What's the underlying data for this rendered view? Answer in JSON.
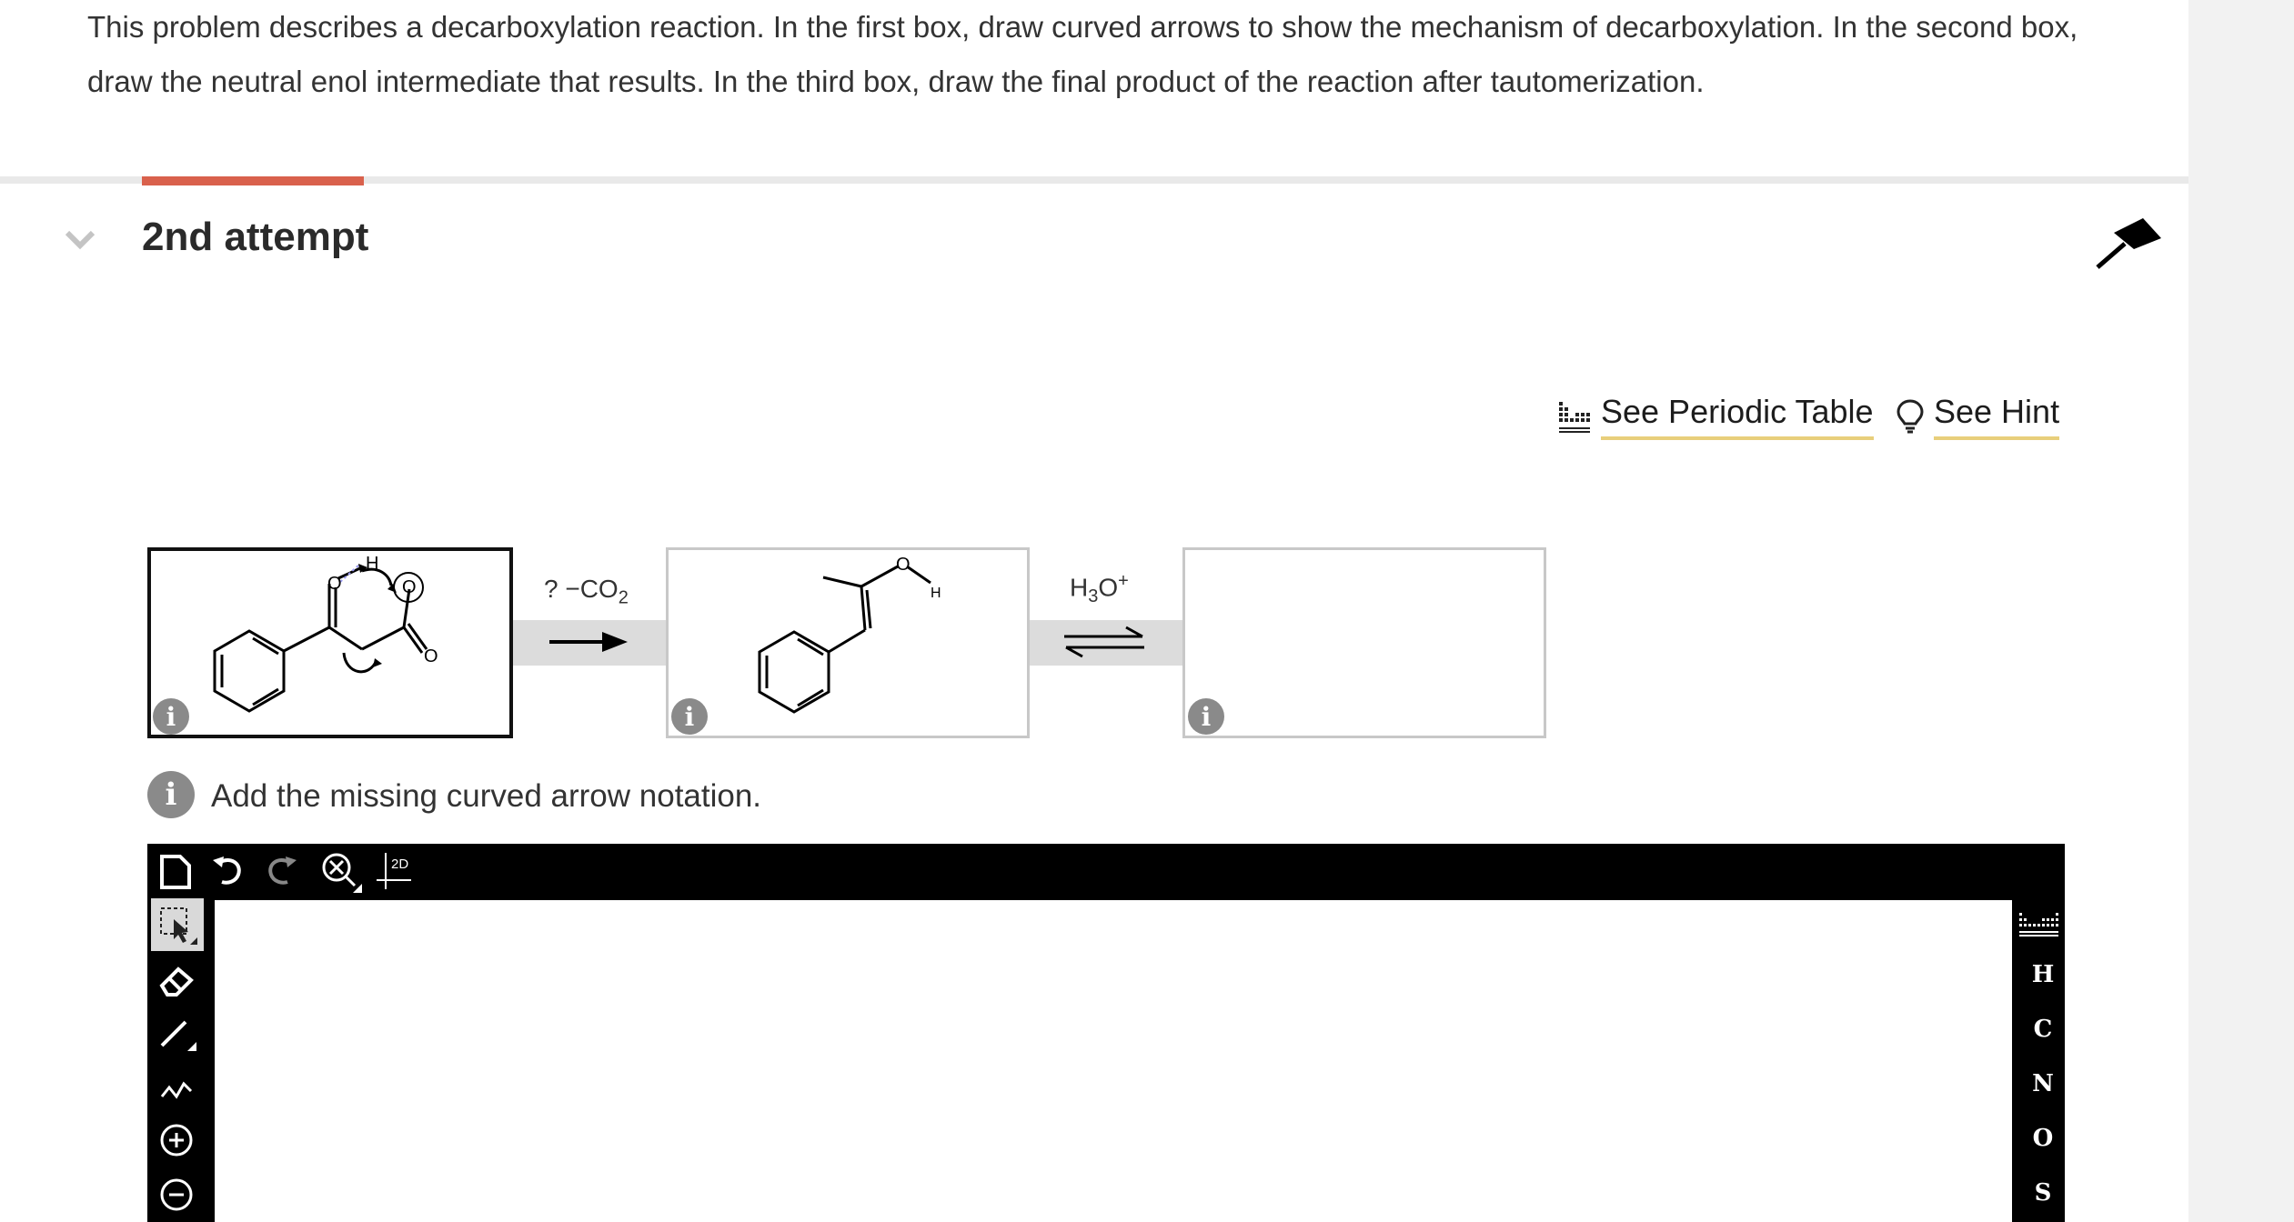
{
  "problem": {
    "line1": "This problem describes a decarboxylation reaction. In the first box, draw curved arrows to show the mechanism of decarboxylation. In the second box,",
    "line2": "draw the neutral enol intermediate that results. In the third box, draw the final product of the reaction after tautomerization."
  },
  "attempt": {
    "title": "2nd attempt"
  },
  "links": {
    "periodic_table": "See Periodic Table",
    "hint": "See Hint"
  },
  "reaction": {
    "step1_prefix": "? ",
    "step1_loss": "−CO",
    "step1_sub": "2",
    "step2_h": "H",
    "step2_sub": "3",
    "step2_o": "O",
    "step2_sup": "+",
    "mol_labels": {
      "o": "O",
      "h": "H"
    }
  },
  "info_glyph": "i",
  "message": "Add the missing curved arrow notation.",
  "editor": {
    "toolbar_2d": "2D",
    "elements": [
      "H",
      "C",
      "N",
      "O",
      "S"
    ]
  },
  "colors": {
    "accent": "#d9614c",
    "link_underline": "#e8cf7b",
    "toolbar": "#000000",
    "info": "#8a8a8a"
  }
}
